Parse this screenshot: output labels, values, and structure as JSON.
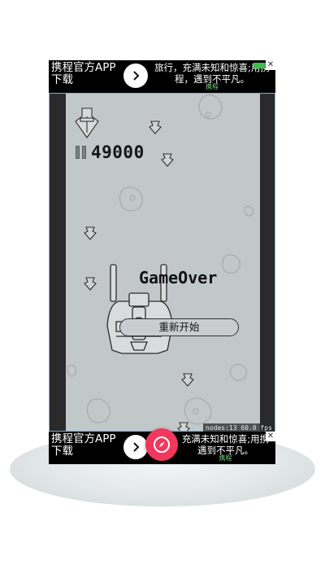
{
  "ads": {
    "top": {
      "left_text": "携程官方APP下载",
      "right_text_line1": "旅行，充满未知和惊喜;用携",
      "right_text_line2": "程，遇到不平凡。",
      "tag": "携程"
    },
    "bottom": {
      "left_text": "携程官方APP下载",
      "right_text_line1": "充满未知和惊喜;用携",
      "right_text_line2": "遇到不平凡。",
      "tag": "携程"
    }
  },
  "hud": {
    "score": "49000"
  },
  "overlay": {
    "title": "GameOver",
    "restart_label": "重新开始"
  },
  "debug": {
    "stats": "nodes:13  60.0 fps"
  },
  "colors": {
    "accent": "#f1375d",
    "field": "#c2c7c9",
    "border": "#7ab0e0"
  },
  "icons": {
    "ad_arrow": "chevron-right-icon",
    "fab": "compass-icon",
    "close": "close-icon"
  }
}
